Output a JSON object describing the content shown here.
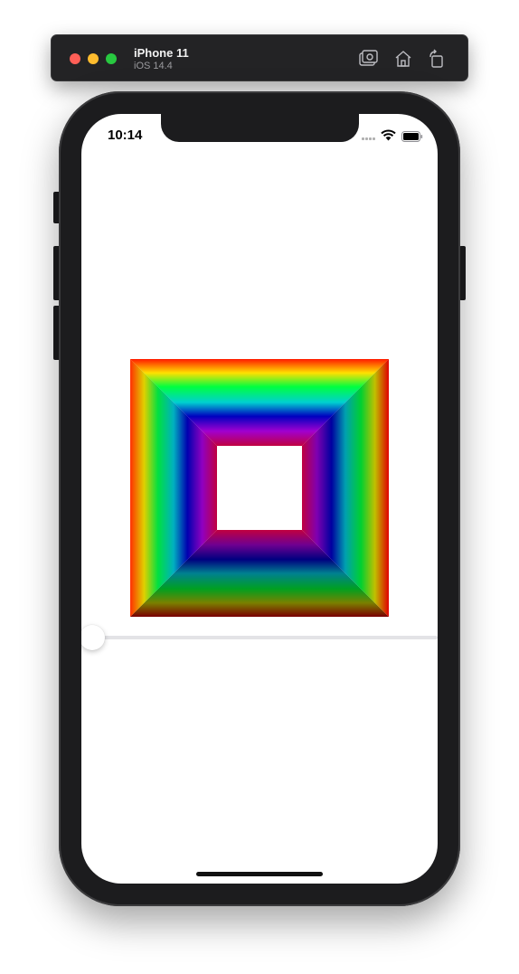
{
  "simulator": {
    "device_name": "iPhone 11",
    "os_version": "iOS 14.4",
    "toolbar": {
      "screenshot_icon": "camera-screenshot-icon",
      "home_icon": "home-icon",
      "rotate_icon": "rotate-icon"
    },
    "colors": {
      "bar": "#232325",
      "close": "#ff5f57",
      "minimize": "#febc2e",
      "zoom": "#28c840"
    }
  },
  "status_bar": {
    "time": "10:14",
    "icons": [
      "cellular-signal-icon",
      "wifi-icon",
      "battery-icon"
    ]
  },
  "content": {
    "artwork": {
      "description_icon": "gradient-square-frame",
      "ring_colors": [
        "#ff1a00",
        "#ffe000",
        "#00ff40",
        "#00d0d0",
        "#0000c0",
        "#a000d0",
        "#c00040"
      ],
      "inner_color": "#ffffff"
    },
    "slider": {
      "value": 0,
      "track_color": "#e3e3e6",
      "thumb_color": "#ffffff"
    }
  }
}
